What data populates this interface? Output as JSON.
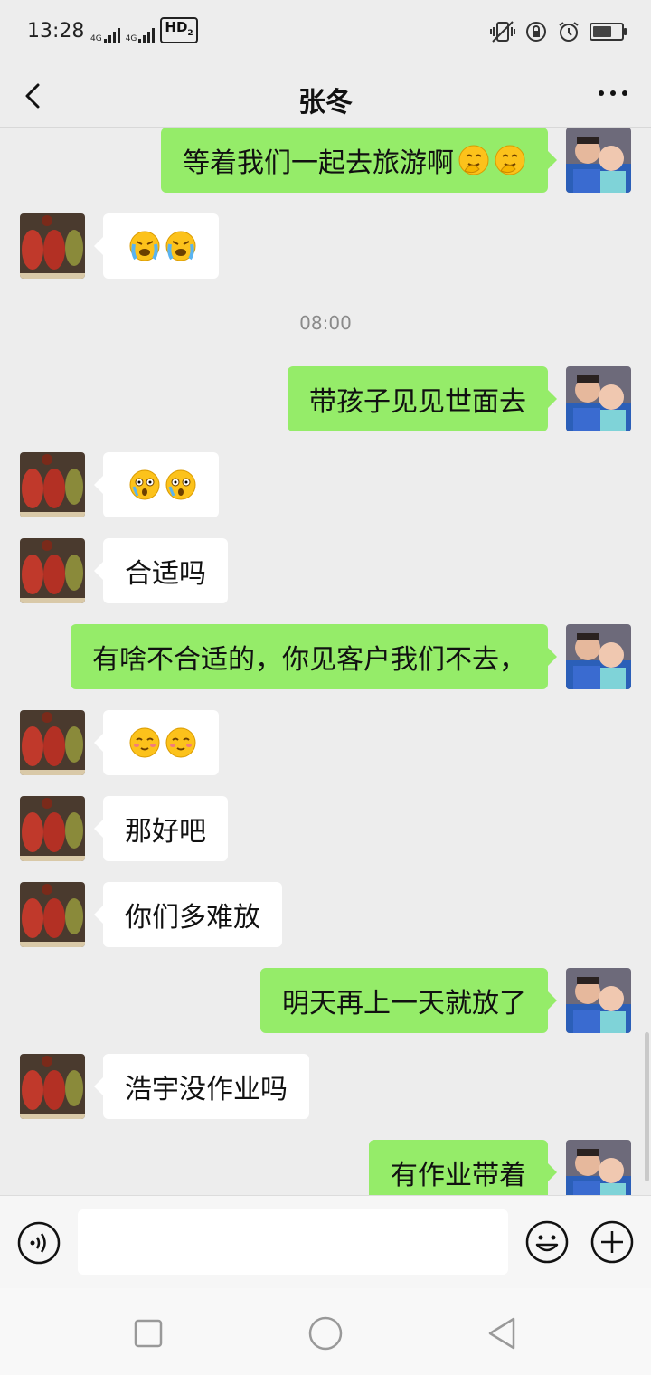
{
  "status_bar": {
    "time": "13:28",
    "net1": "4G",
    "net2": "4G",
    "hd": "HD",
    "hd_sub": "2",
    "icons": [
      "vibrate-icon",
      "lock-rotation-icon",
      "alarm-icon",
      "battery-icon"
    ],
    "battery_level": 0.6
  },
  "header": {
    "title": "张冬",
    "back_icon": "chevron-left-icon",
    "menu_icon": "more-dots-icon"
  },
  "messages": [
    {
      "side": "right",
      "text": "等着我们一起去旅游啊",
      "emojis": [
        "smirk-hand-emoji",
        "smirk-hand-emoji"
      ]
    },
    {
      "side": "left",
      "text": "",
      "emojis": [
        "crying-emoji",
        "crying-emoji"
      ]
    },
    {
      "type": "time",
      "text": "08:00"
    },
    {
      "side": "right",
      "text": "带孩子见见世面去",
      "emojis": []
    },
    {
      "side": "left",
      "text": "",
      "emojis": [
        "shocked-emoji",
        "shocked-emoji"
      ]
    },
    {
      "side": "left",
      "text": "合适吗",
      "emojis": []
    },
    {
      "side": "right",
      "text": "有啥不合适的，你见客户我们不去，",
      "emojis": []
    },
    {
      "side": "left",
      "text": "",
      "emojis": [
        "shy-smile-emoji",
        "shy-smile-emoji"
      ]
    },
    {
      "side": "left",
      "text": "那好吧",
      "emojis": []
    },
    {
      "side": "left",
      "text": "你们多难放",
      "emojis": []
    },
    {
      "side": "right",
      "text": "明天再上一天就放了",
      "emojis": []
    },
    {
      "side": "left",
      "text": "浩宇没作业吗",
      "emojis": []
    },
    {
      "side": "right",
      "text": "有作业带着",
      "emojis": []
    }
  ],
  "input_bar": {
    "voice_icon": "voice-icon",
    "input_value": "",
    "emoji_icon": "emoji-icon",
    "plus_icon": "plus-icon"
  },
  "nav_bar": {
    "icons": [
      "recent-apps-icon",
      "home-icon",
      "back-icon"
    ]
  },
  "colors": {
    "background": "#ededed",
    "bubble_sent": "#95ec69",
    "bubble_received": "#ffffff"
  }
}
